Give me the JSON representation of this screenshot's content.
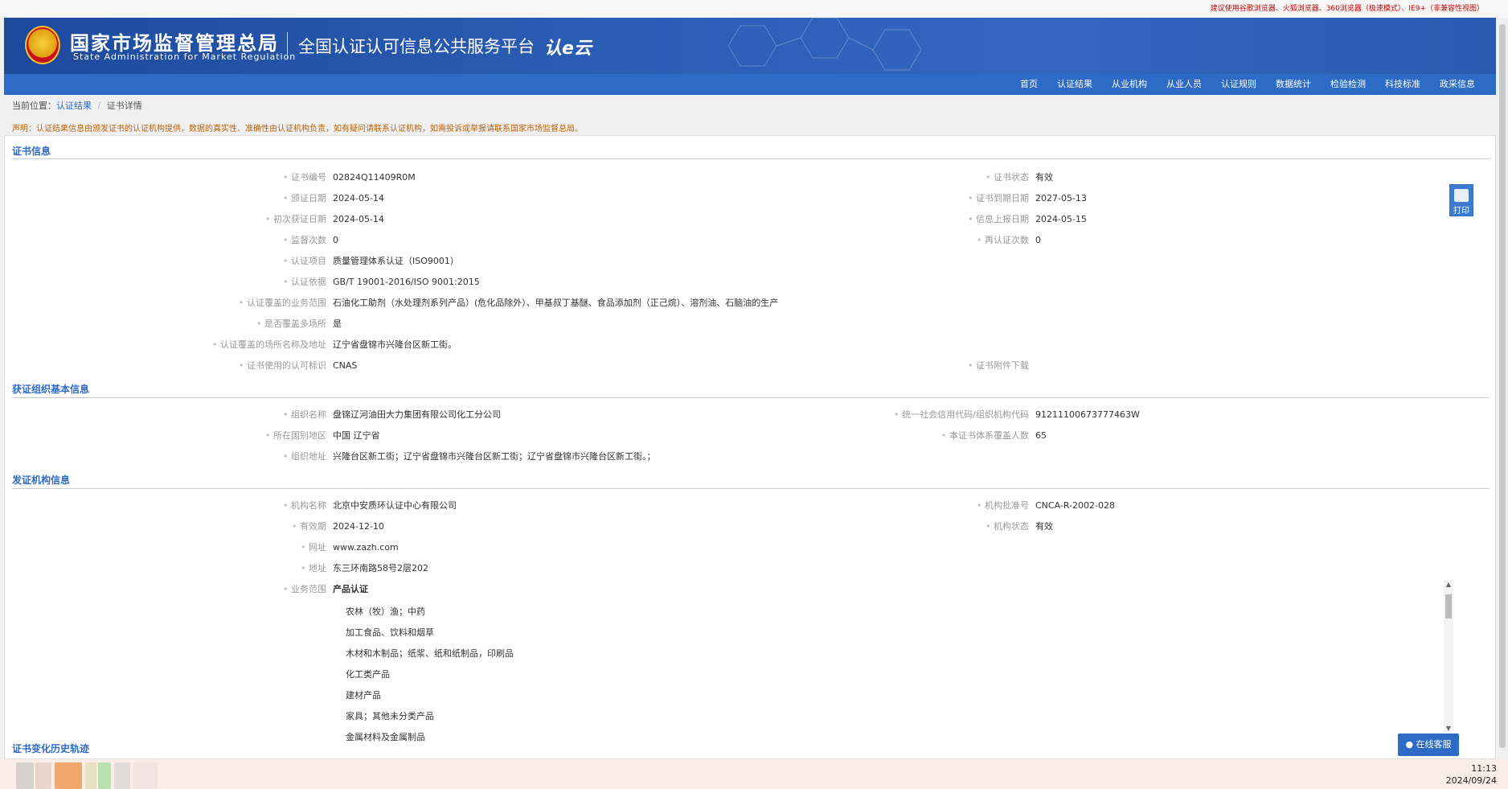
{
  "top_note": "建议使用谷歌浏览器、火狐浏览器、360浏览器（极速模式）、IE9+（非兼容性视图）",
  "header": {
    "org_cn": "国家市场监督管理总局",
    "org_en": "State Administration  for  Market Regulation",
    "platform": "全国认证认可信息公共服务平台",
    "logo_text": "认e云"
  },
  "nav": [
    "首页",
    "认证结果",
    "从业机构",
    "从业人员",
    "认证规则",
    "数据统计",
    "检验检测",
    "科技标准",
    "政采信息"
  ],
  "breadcrumb": {
    "prefix": "当前位置：",
    "link": "认证结果",
    "sep": "/",
    "current": "证书详情"
  },
  "notice": "声明：认证结果信息由颁发证书的认证机构提供，数据的真实性、准确性由认证机构负责，如有疑问请联系认证机构，如需投诉或举报请联系国家市场监督总局。",
  "sections": {
    "cert": "证书信息",
    "org": "获证组织基本信息",
    "issuer": "发证机构信息",
    "history": "证书变化历史轨迹"
  },
  "cert_left": [
    {
      "label": "证书编号",
      "value": "02824Q11409R0M"
    },
    {
      "label": "颁证日期",
      "value": "2024-05-14"
    },
    {
      "label": "初次获证日期",
      "value": "2024-05-14"
    },
    {
      "label": "监督次数",
      "value": "0"
    },
    {
      "label": "认证项目",
      "value": "质量管理体系认证（ISO9001）"
    },
    {
      "label": "认证依据",
      "value": "GB/T 19001-2016/ISO 9001:2015"
    },
    {
      "label": "认证覆盖的业务范围",
      "value": "石油化工助剂（水处理剂系列产品）(危化品除外）、甲基叔丁基醚、食品添加剂（正己烷）、溶剂油、石脑油的生产"
    },
    {
      "label": "是否覆盖多场所",
      "value": "是"
    },
    {
      "label": "认证覆盖的场所名称及地址",
      "value": "辽宁省盘锦市兴隆台区新工街。"
    },
    {
      "label": "证书使用的认可标识",
      "value": "CNAS"
    }
  ],
  "cert_right": [
    {
      "label": "证书状态",
      "value": "有效"
    },
    {
      "label": "证书到期日期",
      "value": "2027-05-13"
    },
    {
      "label": "信息上报日期",
      "value": "2024-05-15"
    },
    {
      "label": "再认证次数",
      "value": "0"
    },
    {
      "label": "证书附件下载",
      "value": ""
    }
  ],
  "org_left": [
    {
      "label": "组织名称",
      "value": "盘锦辽河油田大力集团有限公司化工分公司"
    },
    {
      "label": "所在国别地区",
      "value": "中国 辽宁省"
    },
    {
      "label": "组织地址",
      "value": "兴隆台区新工街；辽宁省盘锦市兴隆台区新工街；辽宁省盘锦市兴隆台区新工街。；"
    }
  ],
  "org_right": [
    {
      "label": "统一社会信用代码/组织机构代码",
      "value": "91211100673777463W"
    },
    {
      "label": "本证书体系覆盖人数",
      "value": "65"
    }
  ],
  "issuer_left": [
    {
      "label": "机构名称",
      "value": "北京中安质环认证中心有限公司"
    },
    {
      "label": "有效期",
      "value": "2024-12-10"
    },
    {
      "label": "网址",
      "value": "www.zazh.com"
    },
    {
      "label": "地址",
      "value": "东三环南路58号2层202"
    },
    {
      "label": "业务范围",
      "value": "产品认证"
    }
  ],
  "issuer_right": [
    {
      "label": "机构批准号",
      "value": "CNCA-R-2002-028"
    },
    {
      "label": "机构状态",
      "value": "有效"
    }
  ],
  "scope_items": [
    "农林（牧）渔；中药",
    "加工食品、饮料和烟草",
    "木材和木制品；纸浆、纸和纸制品，印刷品",
    "化工类产品",
    "建材产品",
    "家具；其他未分类产品",
    "金属材料及金属制品"
  ],
  "print_label": "打印",
  "service_label": "在线客服",
  "clock": {
    "time": "11:13",
    "date": "2024/09/24"
  }
}
